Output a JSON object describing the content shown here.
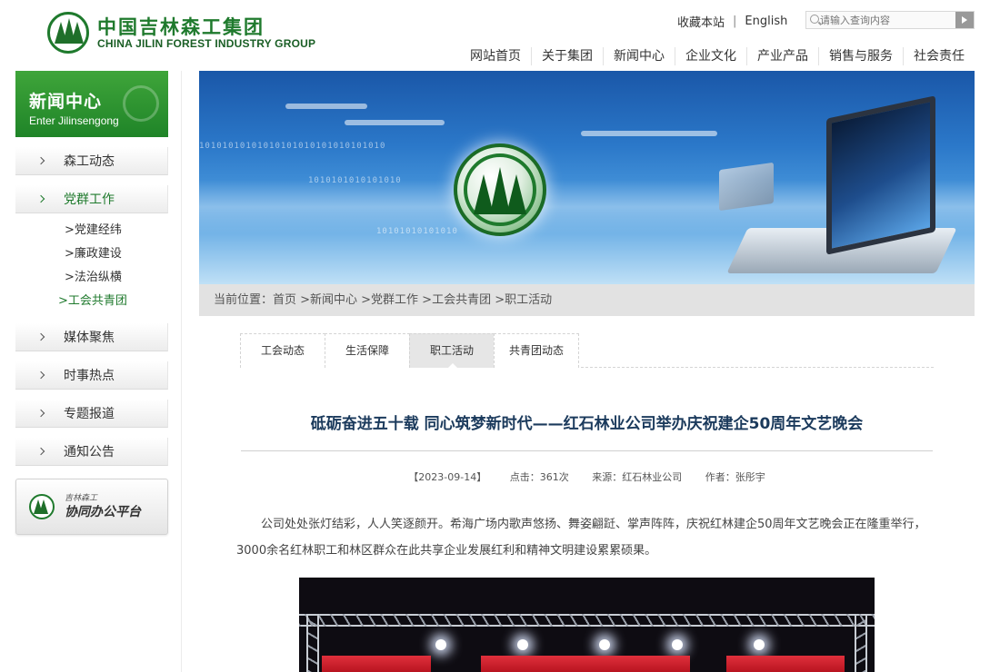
{
  "header": {
    "logo_cn": "中国吉林森工集团",
    "logo_en": "CHINA JILIN FOREST INDUSTRY GROUP",
    "top_links": {
      "favorite": "收藏本站",
      "separator": "|",
      "english": "English"
    },
    "search": {
      "placeholder": "请输入查询内容"
    },
    "nav": [
      "网站首页",
      "关于集团",
      "新闻中心",
      "企业文化",
      "产业产品",
      "销售与服务",
      "社会责任"
    ]
  },
  "sidebar": {
    "title": "新闻中心",
    "subtitle": "Enter Jilinsengong",
    "items": [
      {
        "label": "森工动态"
      },
      {
        "label": "党群工作"
      },
      {
        "label": "媒体聚焦"
      },
      {
        "label": "时事热点"
      },
      {
        "label": "专题报道"
      },
      {
        "label": "通知公告"
      }
    ],
    "subitems": [
      ">党建经纬",
      ">廉政建设",
      ">法治纵横",
      ">工会共青团"
    ],
    "office": {
      "small": "吉林森工",
      "big": "协同办公平台"
    }
  },
  "banner": {
    "bits": [
      "10101010101010101010101010101010",
      "1010101010101010",
      "10101010101010"
    ]
  },
  "breadcrumb": "当前位置：首页 >新闻中心 >党群工作 >工会共青团 >职工活动",
  "tabs": [
    "工会动态",
    "生活保障",
    "职工活动",
    "共青团动态"
  ],
  "article": {
    "title": "砥砺奋进五十载 同心筑梦新时代——红石林业公司举办庆祝建企50周年文艺晚会",
    "date": "【2023-09-14】",
    "clicks": "点击：361次",
    "source": "来源：红石林业公司",
    "author": "作者：张彤宇",
    "body": "公司处处张灯结彩，人人笑逐颜开。希海广场内歌声悠扬、舞姿翩跹、掌声阵阵，庆祝红林建企50周年文艺晚会正在隆重举行，3000余名红林职工和林区群众在此共享企业发展红利和精神文明建设累累硕果。"
  },
  "colors": {
    "brand_green": "#1f7a2d",
    "title_navy": "#1b3a5c",
    "breadcrumb_bg": "#e2e2e2"
  }
}
